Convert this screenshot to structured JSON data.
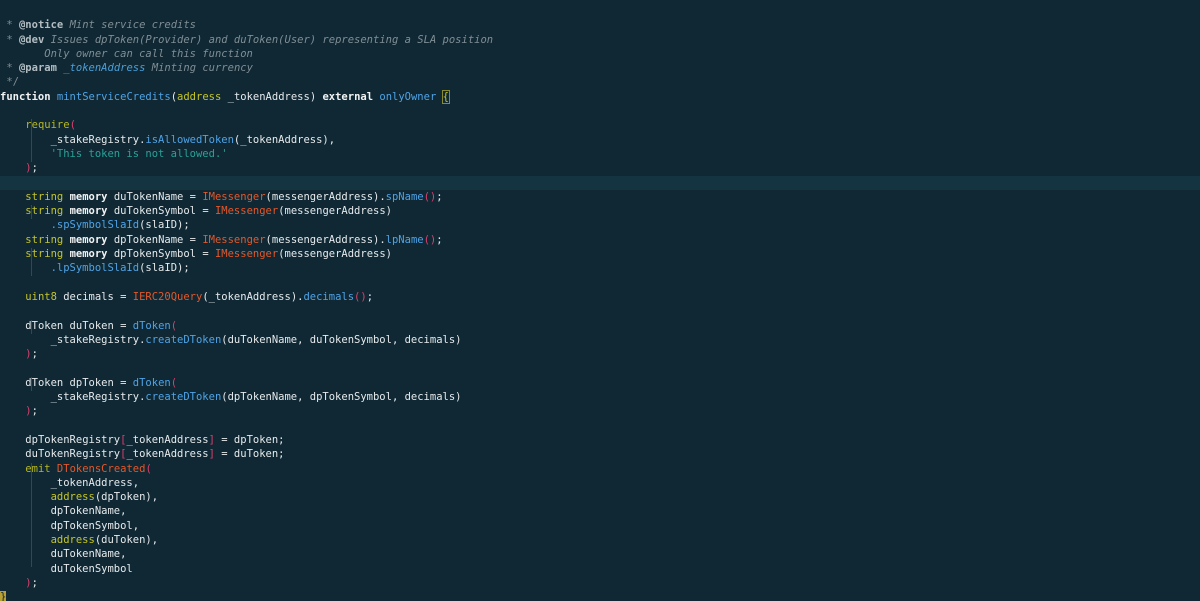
{
  "doc": {
    "notice_tag": "@notice",
    "notice_text": " Mint service credits",
    "dev_tag": "@dev",
    "dev_text": " Issues dpToken(Provider) and duToken(User) representing a SLA position",
    "dev_text2": "Only owner can call this function",
    "param_tag": "@param",
    "param_name": " _tokenAddress",
    "param_text": " Minting currency",
    "star": "*",
    "close": "*/"
  },
  "fn": {
    "keyword": "function",
    "name": "mintServiceCredits",
    "param_type": "address",
    "param_name": " _tokenAddress",
    "external": "external",
    "modifier": "onlyOwner",
    "open_brace": "{",
    "close_brace": "}"
  },
  "require": {
    "name": "require",
    "registry": "_stakeRegistry.",
    "method": "isAllowedToken",
    "arg": "(_tokenAddress),",
    "message": "'This token is not allowed.'",
    "close": ");"
  },
  "strings": {
    "type": "string",
    "memory": "memory",
    "iface": "IMessenger",
    "du_name_var": " duTokenName = ",
    "du_symbol_var": " duTokenSymbol = ",
    "dp_name_var": " dpTokenName = ",
    "dp_symbol_var": " dpTokenSymbol = ",
    "messenger_arg": "(messengerAddress).",
    "messenger_arg_open": "(messengerAddress)",
    "sp_name": "spName",
    "lp_name": "lpName",
    "sp_symbol": ".spSymbolSlaId",
    "lp_symbol": ".lpSymbolSlaId",
    "sla_arg": "(slaID);",
    "call_end": "();"
  },
  "decimals": {
    "type": "uint8",
    "var": " decimals = ",
    "iface": "IERC20Query",
    "arg": "(_tokenAddress).",
    "method": "decimals",
    "end": "();"
  },
  "du_token": {
    "type": "dToken",
    "var": " duToken = ",
    "ctor": "dToken",
    "registry": "_stakeRegistry.",
    "method": "createDToken",
    "args": "(duTokenName, duTokenSymbol, decimals)",
    "close": ");"
  },
  "dp_token": {
    "type": "dToken",
    "var": " dpToken = ",
    "ctor": "dToken",
    "registry": "_stakeRegistry.",
    "method": "createDToken",
    "args": "(dpTokenName, dpTokenSymbol, decimals)",
    "close": ");"
  },
  "registry": {
    "dp_name": "dpTokenRegistry",
    "du_name": "duTokenRegistry",
    "key": "_tokenAddress",
    "dp_assign": " = dpToken;",
    "du_assign": " = duToken;",
    "lbr": "[",
    "rbr": "]"
  },
  "emit": {
    "keyword": "emit",
    "event": "DTokensCreated",
    "a1": "_tokenAddress,",
    "addr": "address",
    "a2": "(dpToken),",
    "a3": "dpTokenName,",
    "a4": "dpTokenSymbol,",
    "a5": "(duToken),",
    "a6": "duTokenName,",
    "a7": "duTokenSymbol",
    "close": ");"
  }
}
